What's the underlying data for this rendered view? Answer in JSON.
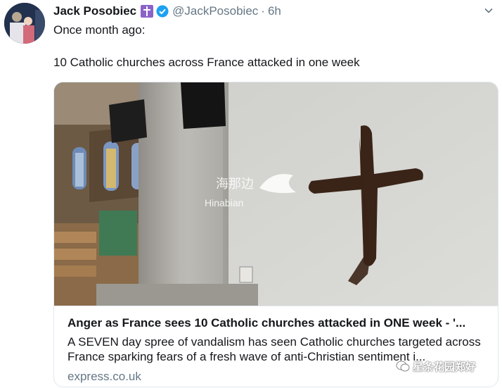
{
  "tweet": {
    "display_name": "Jack Posobiec",
    "handle": "@JackPosobiec",
    "separator": "·",
    "time": "6h",
    "text_line1": "Once month ago:",
    "text_line2": "10 Catholic churches across France attacked in one week",
    "badges": [
      "cross-icon",
      "verified-icon"
    ]
  },
  "card": {
    "image_watermark_cn": "海那边",
    "image_watermark_en": "Hinabian",
    "title": "Anger as France sees 10 Catholic churches attacked in ONE week - '...",
    "description": "A SEVEN day spree of vandalism has seen Catholic churches targeted across France sparking fears of a fresh wave of anti-Christian sentiment i...",
    "domain": "express.co.uk"
  },
  "watermark": {
    "text": "星条花园郑好"
  },
  "colors": {
    "name": "#14171a",
    "secondary": "#657786",
    "verified": "#1da1f2",
    "cross_badge": "#8b63c8",
    "border": "#e1e8ed"
  }
}
